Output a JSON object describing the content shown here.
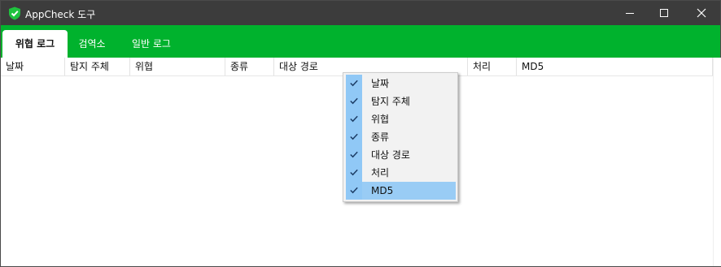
{
  "window": {
    "title": "AppCheck 도구",
    "controls": {
      "minimize": "minimize-icon",
      "maximize": "maximize-icon",
      "close": "close-icon"
    }
  },
  "tabs": [
    {
      "label": "위협 로그",
      "active": true
    },
    {
      "label": "검역소",
      "active": false
    },
    {
      "label": "일반 로그",
      "active": false
    }
  ],
  "table": {
    "columns": [
      "날짜",
      "탐지 주체",
      "위협",
      "종류",
      "대상 경로",
      "처리",
      "MD5"
    ],
    "rows": []
  },
  "context_menu": {
    "items": [
      {
        "label": "날짜",
        "checked": true
      },
      {
        "label": "탐지 주체",
        "checked": true
      },
      {
        "label": "위협",
        "checked": true
      },
      {
        "label": "종류",
        "checked": true
      },
      {
        "label": "대상 경로",
        "checked": true
      },
      {
        "label": "처리",
        "checked": true
      },
      {
        "label": "MD5",
        "checked": true,
        "highlighted": true
      }
    ]
  },
  "colors": {
    "accent": "#00b22d",
    "titlebar": "#3c3c3c",
    "menu_highlight": "#99ccf5",
    "check_background": "#90c8f6"
  }
}
